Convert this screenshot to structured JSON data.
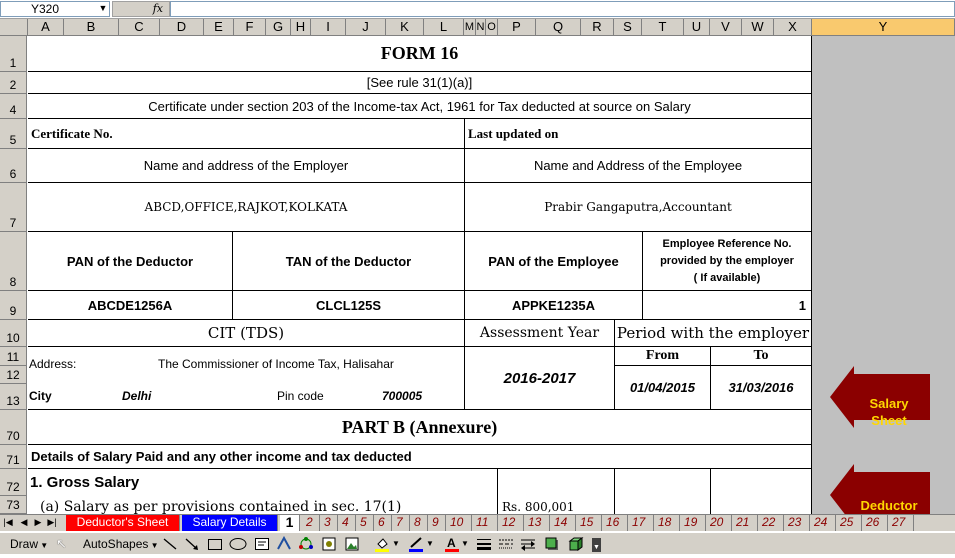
{
  "formula_bar": {
    "name_box": "Y320",
    "fx_label": "fx",
    "formula": ""
  },
  "columns": [
    "A",
    "B",
    "C",
    "D",
    "E",
    "F",
    "G",
    "H",
    "I",
    "J",
    "K",
    "L",
    "M",
    "N",
    "O",
    "P",
    "Q",
    "R",
    "S",
    "T",
    "U",
    "V",
    "W",
    "X",
    "Y"
  ],
  "rows": [
    "1",
    "2",
    "4",
    "5",
    "6",
    "7",
    "8",
    "9",
    "10",
    "11",
    "12",
    "13",
    "70",
    "71",
    "72",
    "73"
  ],
  "form": {
    "title": "FORM 16",
    "rule": "[See rule 31(1)(a)]",
    "certificate_line": "Certificate under section 203 of the Income-tax Act, 1961 for Tax deducted at source on Salary",
    "certificate_no_label": "Certificate No.",
    "last_updated_label": "Last updated on",
    "employer_header": "Name and address of the Employer",
    "employee_header": "Name and Address of the Employee",
    "employer_value": "ABCD,OFFICE,RAJKOT,KOLKATA",
    "employee_value": "Prabir Gangaputra,Accountant",
    "pan_deductor_label": "PAN of the Deductor",
    "tan_deductor_label": "TAN of the Deductor",
    "pan_employee_label": "PAN of the Employee",
    "emp_ref_label_1": "Employee Reference No.",
    "emp_ref_label_2": "provided by the employer",
    "emp_ref_label_3": "( If available)",
    "pan_deductor_value": "ABCDE1256A",
    "tan_deductor_value": "CLCL125S",
    "pan_employee_value": "APPKE1235A",
    "emp_ref_value": "1",
    "cit_label": "CIT (TDS)",
    "assessment_year_label": "Assessment Year",
    "period_label": "Period with the employer",
    "from_label": "From",
    "to_label": "To",
    "address_label": "Address:",
    "address_value": "The Commissioner of Income Tax, Halisahar",
    "assessment_year_value": "2016-2017",
    "from_value": "01/04/2015",
    "to_value": "31/03/2016",
    "city_label": "City",
    "city_value": "Delhi",
    "pincode_label": "Pin code",
    "pincode_value": "700005",
    "part_b_title": "PART B (Annexure)",
    "details_line": "Details of Salary Paid and any other income and tax deducted",
    "gross_salary": "1.  Gross Salary",
    "salary_provision": "(a) Salary as per provisions contained in sec. 17(1)",
    "salary_amount": "Rs. 800,001"
  },
  "buttons": {
    "salary_sheet_1": "Salary",
    "salary_sheet_2": "Sheet",
    "deductor": "Deductor"
  },
  "sheet_tabs": {
    "named": [
      "Deductor's Sheet",
      "Salary Details",
      "1"
    ],
    "numbered": [
      "2",
      "3",
      "4",
      "5",
      "6",
      "7",
      "8",
      "9",
      "10",
      "11",
      "12",
      "13",
      "14",
      "15",
      "16",
      "17",
      "18",
      "19",
      "20",
      "21",
      "22",
      "23",
      "24",
      "25",
      "26",
      "27"
    ]
  },
  "draw_toolbar": {
    "draw": "Draw",
    "autoshapes": "AutoShapes"
  },
  "colors": {
    "arrow_fill": "#8b0000",
    "arrow_text": "#ffd700",
    "tab_deductor": "#ff0000",
    "tab_salary": "#0000ff"
  }
}
